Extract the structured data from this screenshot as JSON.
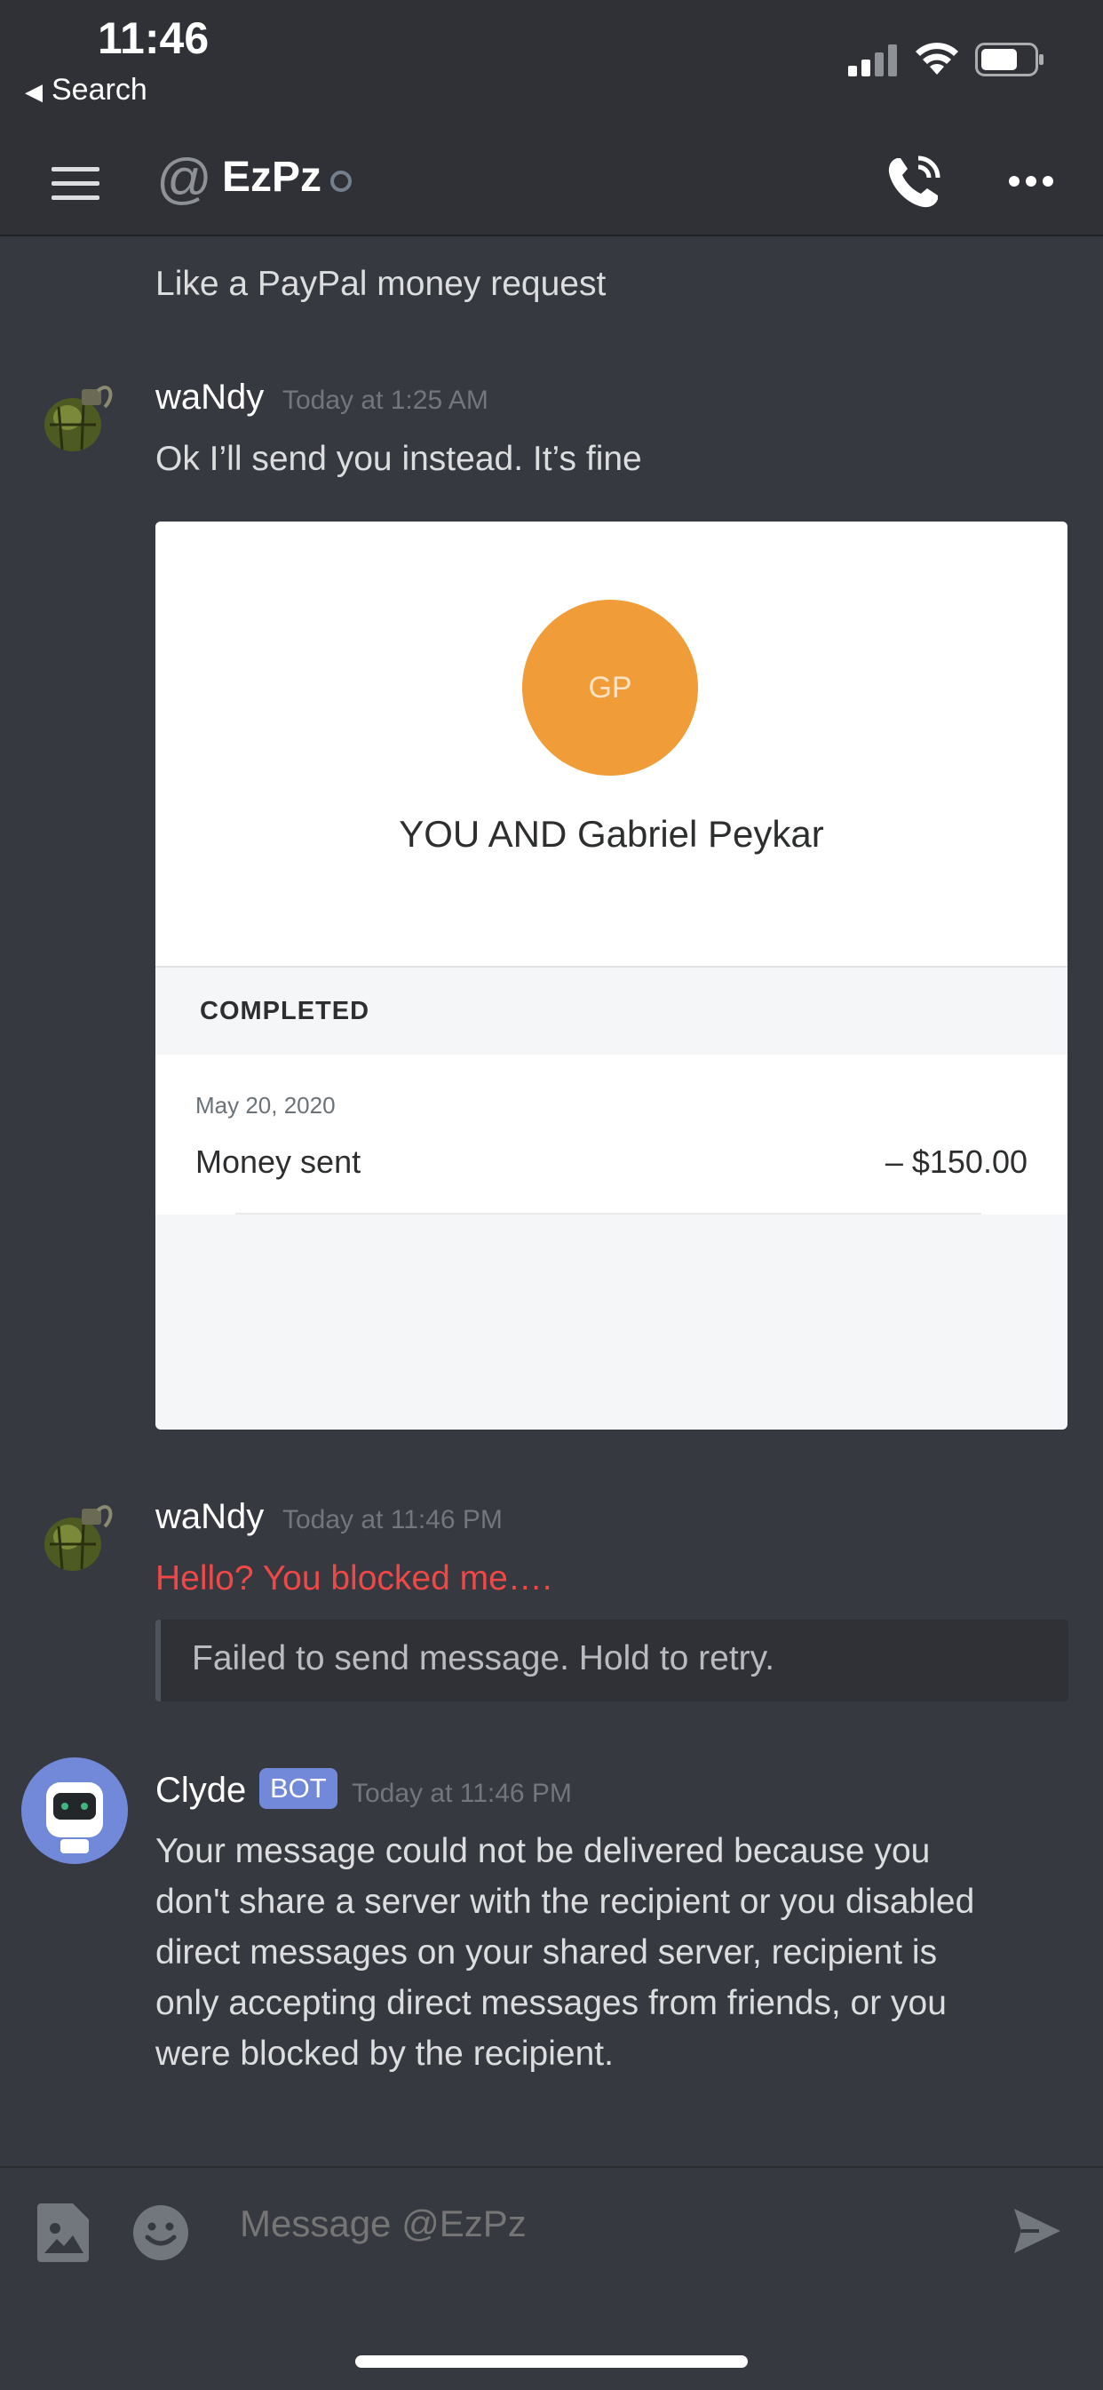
{
  "status_bar": {
    "time": "11:46",
    "back_label": "Search"
  },
  "header": {
    "title": "EzPz",
    "at_symbol": "@"
  },
  "messages": {
    "prev_line": "Like a PayPal money request",
    "m1": {
      "author": "waNdy",
      "timestamp": "Today at 1:25 AM",
      "text": "Ok I’ll send you instead. It’s fine"
    },
    "m2": {
      "author": "waNdy",
      "timestamp": "Today at 11:46 PM",
      "text": "Hello? You blocked me….",
      "failed_note": "Failed to send message. Hold to retry."
    },
    "m3": {
      "author": "Clyde",
      "badge": "BOT",
      "timestamp": "Today at 11:46 PM",
      "lines": [
        "Your message could not be delivered because you",
        "don't share a server with the recipient or you disabled",
        "direct messages on your shared server, recipient is",
        "only accepting direct messages from friends, or you",
        "were blocked by the recipient."
      ]
    }
  },
  "paypal_card": {
    "initials": "GP",
    "name": "YOU AND Gabriel Peykar",
    "status": "COMPLETED",
    "date": "May 20, 2020",
    "label": "Money sent",
    "amount": "– $150.00"
  },
  "composer": {
    "placeholder": "Message @EzPz"
  },
  "colors": {
    "background": "#36393f",
    "header": "#2f3136",
    "error_text": "#f04747",
    "bot_badge": "#7289da",
    "paypal_avatar": "#f09c38"
  }
}
